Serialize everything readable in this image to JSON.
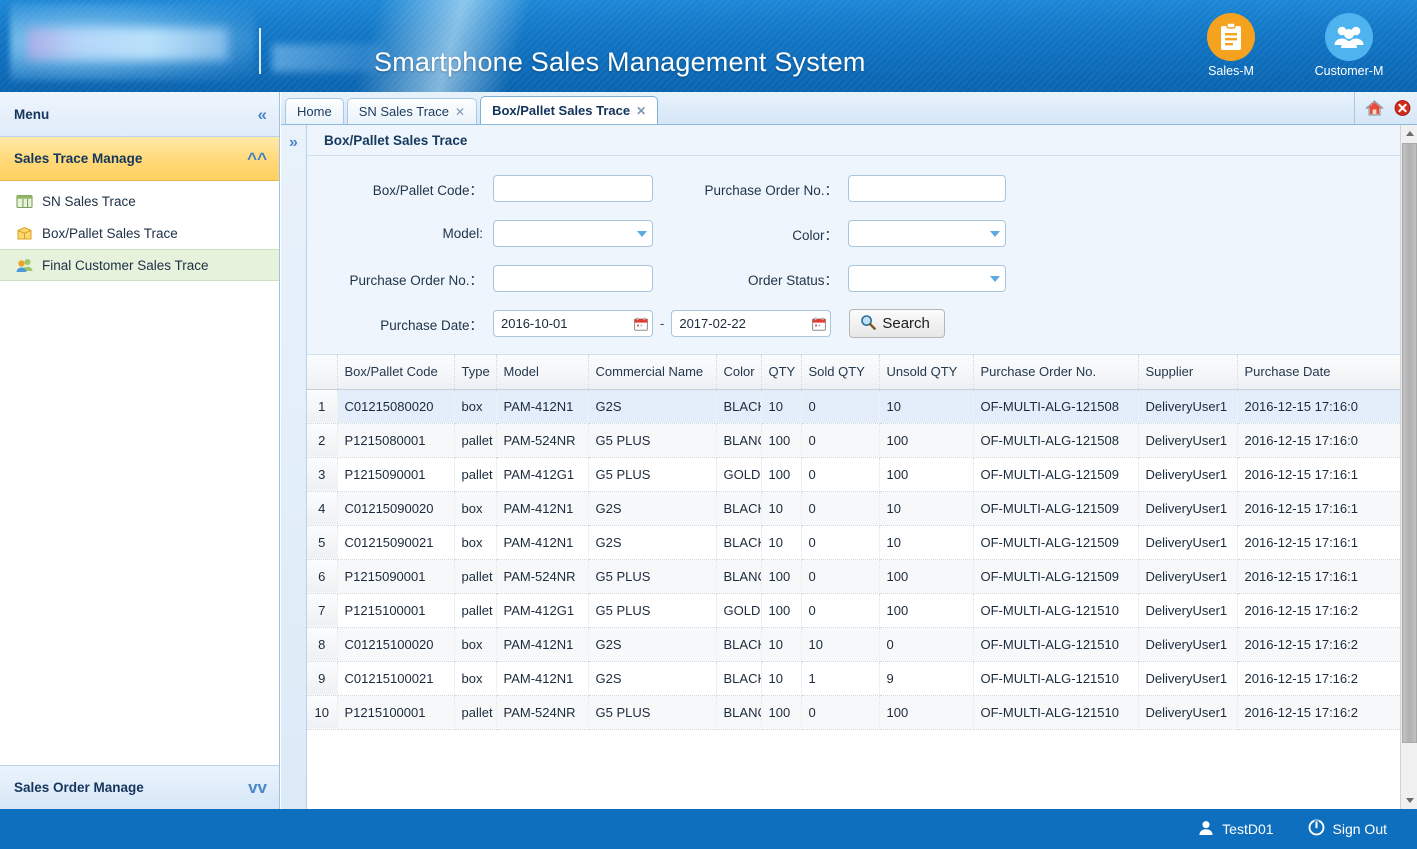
{
  "banner": {
    "title": "Smartphone Sales Management System",
    "icons": [
      {
        "label": "Sales-M",
        "icon": "clipboard-icon",
        "color": "#f5a21e"
      },
      {
        "label": "Customer-M",
        "icon": "users-icon",
        "color": "#4fb3ef"
      }
    ]
  },
  "sidebar": {
    "menu_label": "Menu",
    "collapse_icon": "chevron-double-left-icon",
    "group": {
      "label": "Sales Trace Manage",
      "expand_icon": "chevron-double-up-icon",
      "items": [
        {
          "label": "SN Sales Trace",
          "icon": "table-icon",
          "active": false
        },
        {
          "label": "Box/Pallet Sales Trace",
          "icon": "box-icon",
          "active": false
        },
        {
          "label": "Final Customer Sales Trace",
          "icon": "people-icon",
          "active": true
        }
      ]
    },
    "group_footer": {
      "label": "Sales Order Manage",
      "expand_icon": "chevron-double-down-icon"
    }
  },
  "tabs": [
    {
      "label": "Home",
      "closable": false,
      "active": false
    },
    {
      "label": "SN Sales Trace",
      "closable": true,
      "active": false
    },
    {
      "label": "Box/Pallet Sales Trace",
      "closable": true,
      "active": true
    }
  ],
  "tabbar_buttons": [
    {
      "name": "home-icon",
      "title": "Home"
    },
    {
      "name": "close-all-icon",
      "title": "Close"
    }
  ],
  "panel": {
    "title": "Box/Pallet Sales Trace",
    "rail_icon": "chevron-double-right-icon"
  },
  "search_form": {
    "rows": [
      {
        "left": {
          "label": "Box/Pallet Code：",
          "type": "text",
          "value": "",
          "placeholder": ""
        },
        "right": {
          "label": "Purchase Order No.：",
          "type": "text",
          "value": "",
          "placeholder": ""
        }
      },
      {
        "left": {
          "label": "Model:",
          "type": "select",
          "value": "",
          "options": []
        },
        "right": {
          "label": "Color：",
          "type": "select",
          "value": "",
          "options": []
        }
      },
      {
        "left": {
          "label": "Purchase Order No.：",
          "type": "text",
          "value": "",
          "placeholder": ""
        },
        "right": {
          "label": "Order Status：",
          "type": "select",
          "value": "",
          "options": []
        }
      }
    ],
    "date_row": {
      "label": "Purchase Date：",
      "from_value": "2016-10-01",
      "to_value": "2017-02-22",
      "separator": "-",
      "calendar_icon": "calendar-icon",
      "search_button": {
        "label": "Search",
        "icon": "magnifier-icon"
      }
    }
  },
  "table": {
    "index_header": "",
    "columns": [
      "Box/Pallet Code",
      "Type",
      "Model",
      "Commercial Name",
      "Color",
      "QTY",
      "Sold QTY",
      "Unsold QTY",
      "Purchase Order No.",
      "Supplier",
      "Purchase Date"
    ],
    "rows": [
      {
        "idx": "1",
        "cells": [
          "C01215080020",
          "box",
          "PAM-412N1",
          "G2S",
          "BLACK",
          "10",
          "0",
          "10",
          "OF-MULTI-ALG-121508",
          "DeliveryUser1",
          "2016-12-15 17:16:0"
        ]
      },
      {
        "idx": "2",
        "cells": [
          "P1215080001",
          "pallet",
          "PAM-524NR",
          "G5 PLUS",
          "BLANC",
          "100",
          "0",
          "100",
          "OF-MULTI-ALG-121508",
          "DeliveryUser1",
          "2016-12-15 17:16:0"
        ]
      },
      {
        "idx": "3",
        "cells": [
          "P1215090001",
          "pallet",
          "PAM-412G1",
          "G5 PLUS",
          "GOLD",
          "100",
          "0",
          "100",
          "OF-MULTI-ALG-121509",
          "DeliveryUser1",
          "2016-12-15 17:16:1"
        ]
      },
      {
        "idx": "4",
        "cells": [
          "C01215090020",
          "box",
          "PAM-412N1",
          "G2S",
          "BLACK",
          "10",
          "0",
          "10",
          "OF-MULTI-ALG-121509",
          "DeliveryUser1",
          "2016-12-15 17:16:1"
        ]
      },
      {
        "idx": "5",
        "cells": [
          "C01215090021",
          "box",
          "PAM-412N1",
          "G2S",
          "BLACK",
          "10",
          "0",
          "10",
          "OF-MULTI-ALG-121509",
          "DeliveryUser1",
          "2016-12-15 17:16:1"
        ]
      },
      {
        "idx": "6",
        "cells": [
          "P1215090001",
          "pallet",
          "PAM-524NR",
          "G5 PLUS",
          "BLANC",
          "100",
          "0",
          "100",
          "OF-MULTI-ALG-121509",
          "DeliveryUser1",
          "2016-12-15 17:16:1"
        ]
      },
      {
        "idx": "7",
        "cells": [
          "P1215100001",
          "pallet",
          "PAM-412G1",
          "G5 PLUS",
          "GOLD",
          "100",
          "0",
          "100",
          "OF-MULTI-ALG-121510",
          "DeliveryUser1",
          "2016-12-15 17:16:2"
        ]
      },
      {
        "idx": "8",
        "cells": [
          "C01215100020",
          "box",
          "PAM-412N1",
          "G2S",
          "BLACK",
          "10",
          "10",
          "0",
          "OF-MULTI-ALG-121510",
          "DeliveryUser1",
          "2016-12-15 17:16:2"
        ]
      },
      {
        "idx": "9",
        "cells": [
          "C01215100021",
          "box",
          "PAM-412N1",
          "G2S",
          "BLACK",
          "10",
          "1",
          "9",
          "OF-MULTI-ALG-121510",
          "DeliveryUser1",
          "2016-12-15 17:16:2"
        ]
      },
      {
        "idx": "10",
        "cells": [
          "P1215100001",
          "pallet",
          "PAM-524NR",
          "G5 PLUS",
          "BLANC",
          "100",
          "0",
          "100",
          "OF-MULTI-ALG-121510",
          "DeliveryUser1",
          "2016-12-15 17:16:2"
        ]
      }
    ]
  },
  "footer": {
    "user": {
      "label": "TestD01",
      "icon": "user-icon"
    },
    "signout": {
      "label": "Sign Out",
      "icon": "power-icon"
    }
  },
  "colors": {
    "brand_blue": "#0e6fbe",
    "accent_orange": "#f5a21e",
    "accent_lightblue": "#4fb3ef",
    "menu_group_yellow": "#ffd978",
    "active_item_green": "#e7f2dd",
    "selected_row_blue": "#e4eefb"
  }
}
